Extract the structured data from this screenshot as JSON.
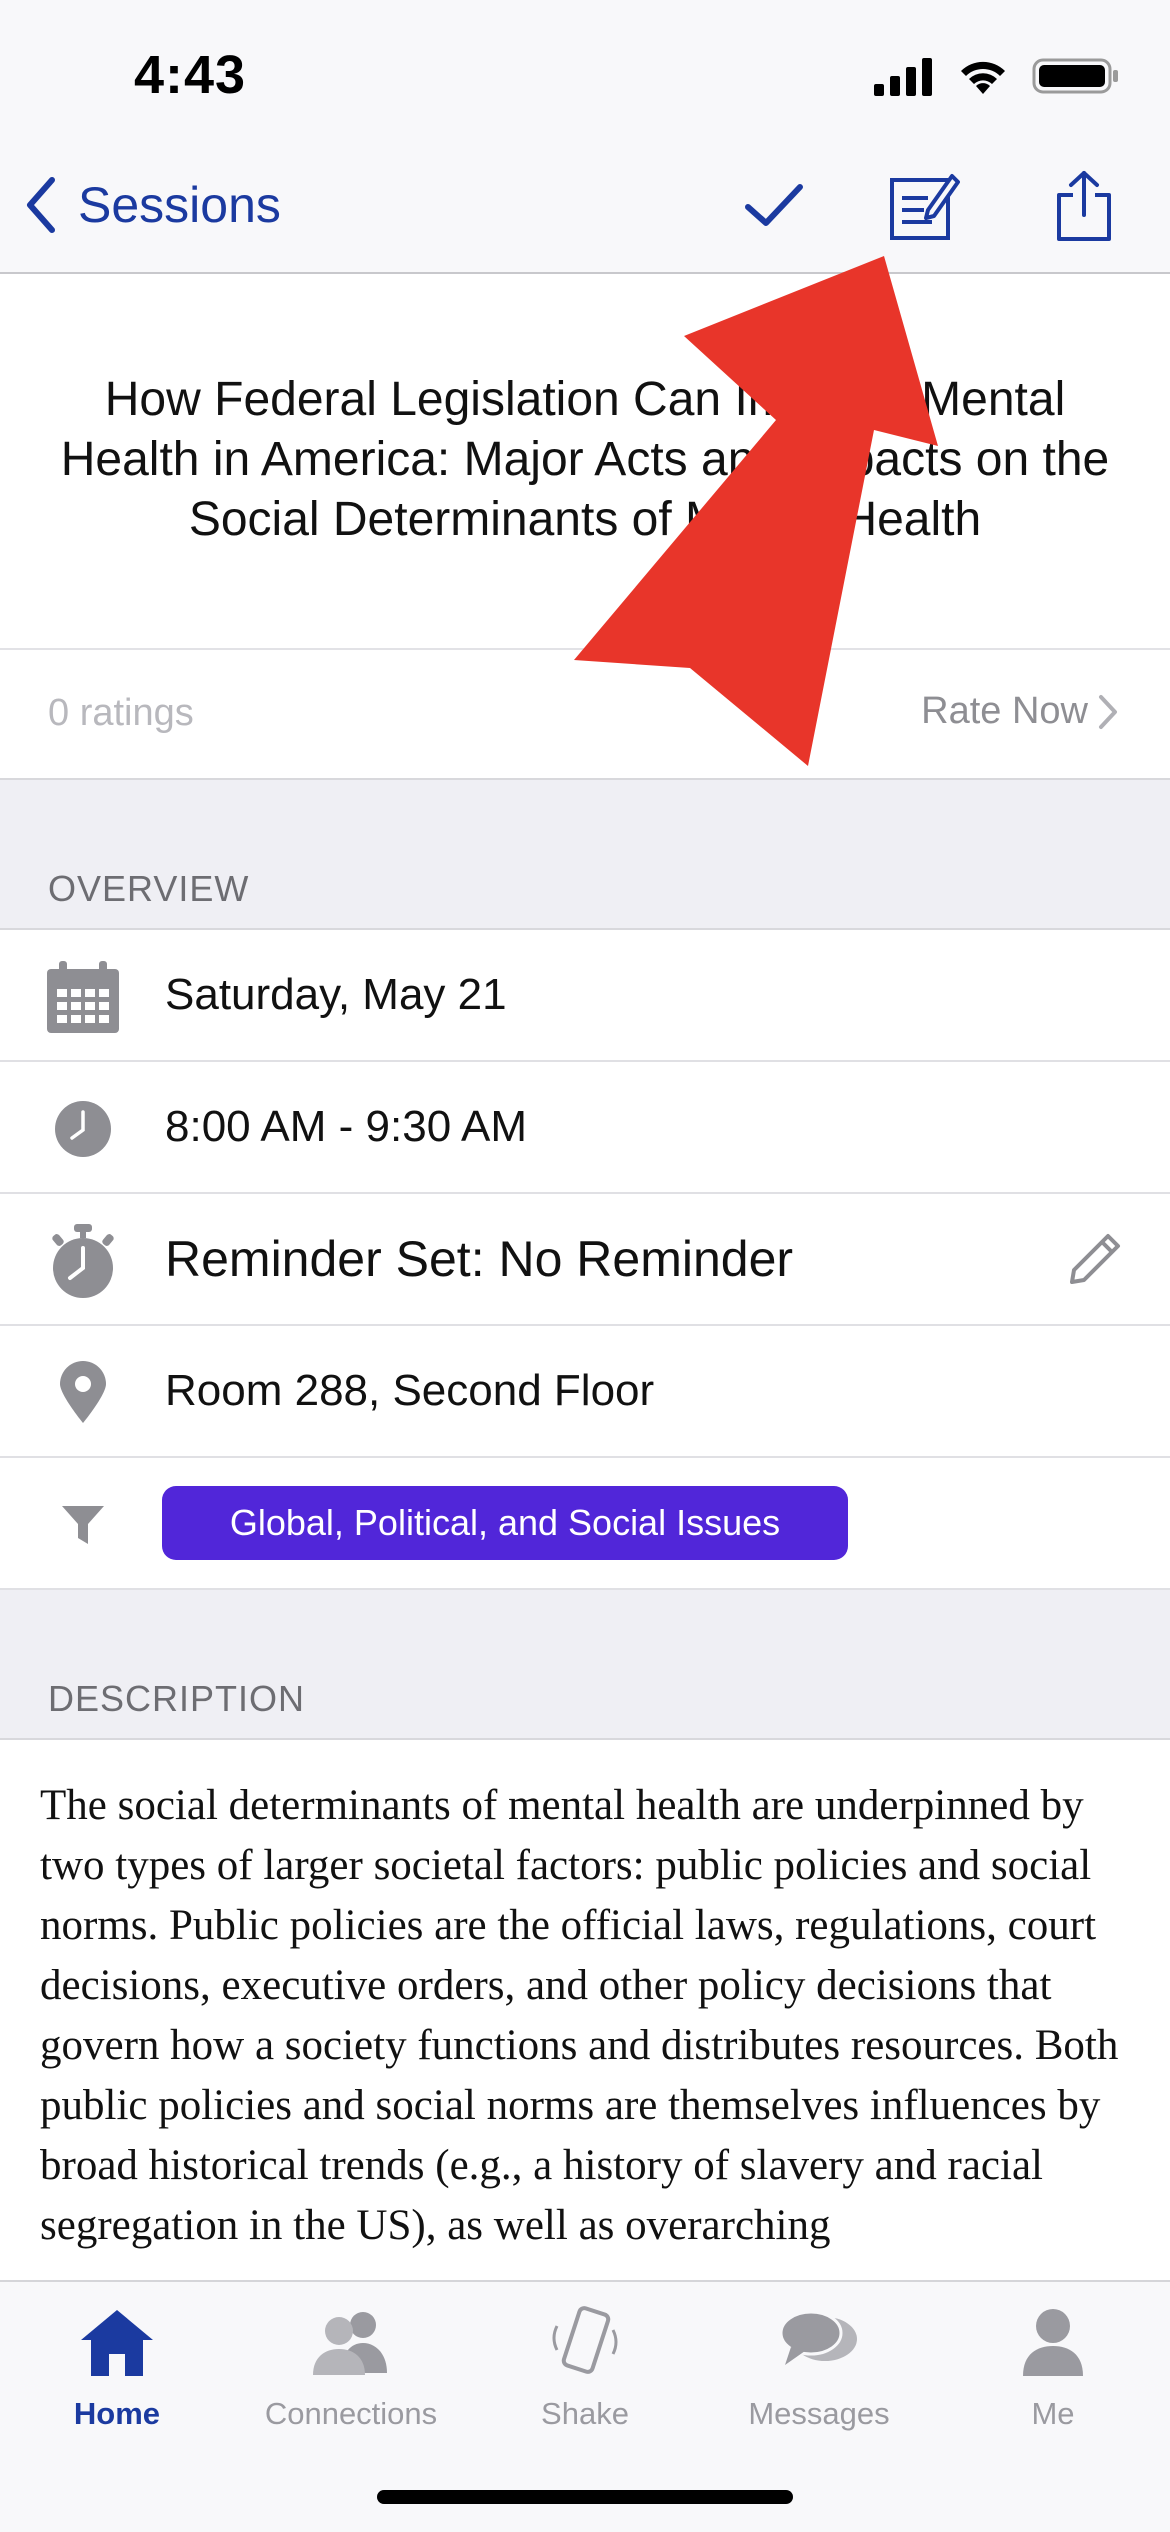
{
  "status_bar": {
    "time": "4:43"
  },
  "nav": {
    "back_label": "Sessions"
  },
  "session": {
    "title": "How Federal Legislation Can Improve Mental Health in America: Major Acts and Impacts on the Social Determinants of Mental Health",
    "ratings_count": "0 ratings",
    "rate_now_label": "Rate Now"
  },
  "overview": {
    "header": "OVERVIEW",
    "date": "Saturday, May 21",
    "time": "8:00 AM - 9:30 AM",
    "reminder": "Reminder Set: No Reminder",
    "location": "Room 288, Second Floor",
    "track": "Global, Political, and Social Issues",
    "track_color": "#5126d9"
  },
  "description": {
    "header": "DESCRIPTION",
    "text": "The social determinants of mental health are underpinned by two types of larger societal factors: public policies and social norms. Public policies are the official laws, regulations, court decisions, executive orders, and other policy decisions that govern how a society functions and distributes resources. Both public policies and social norms are themselves influences by broad historical trends (e.g., a history of slavery and racial segregation in the US), as well as overarching"
  },
  "tab_bar": {
    "items": [
      {
        "label": "Home",
        "icon": "home-icon"
      },
      {
        "label": "Connections",
        "icon": "connections-icon"
      },
      {
        "label": "Shake",
        "icon": "shake-icon"
      },
      {
        "label": "Messages",
        "icon": "messages-icon"
      },
      {
        "label": "Me",
        "icon": "person-icon"
      }
    ],
    "active": "Home"
  },
  "colors": {
    "accent": "#1b3aa0",
    "annotation_arrow": "#e8352a"
  }
}
